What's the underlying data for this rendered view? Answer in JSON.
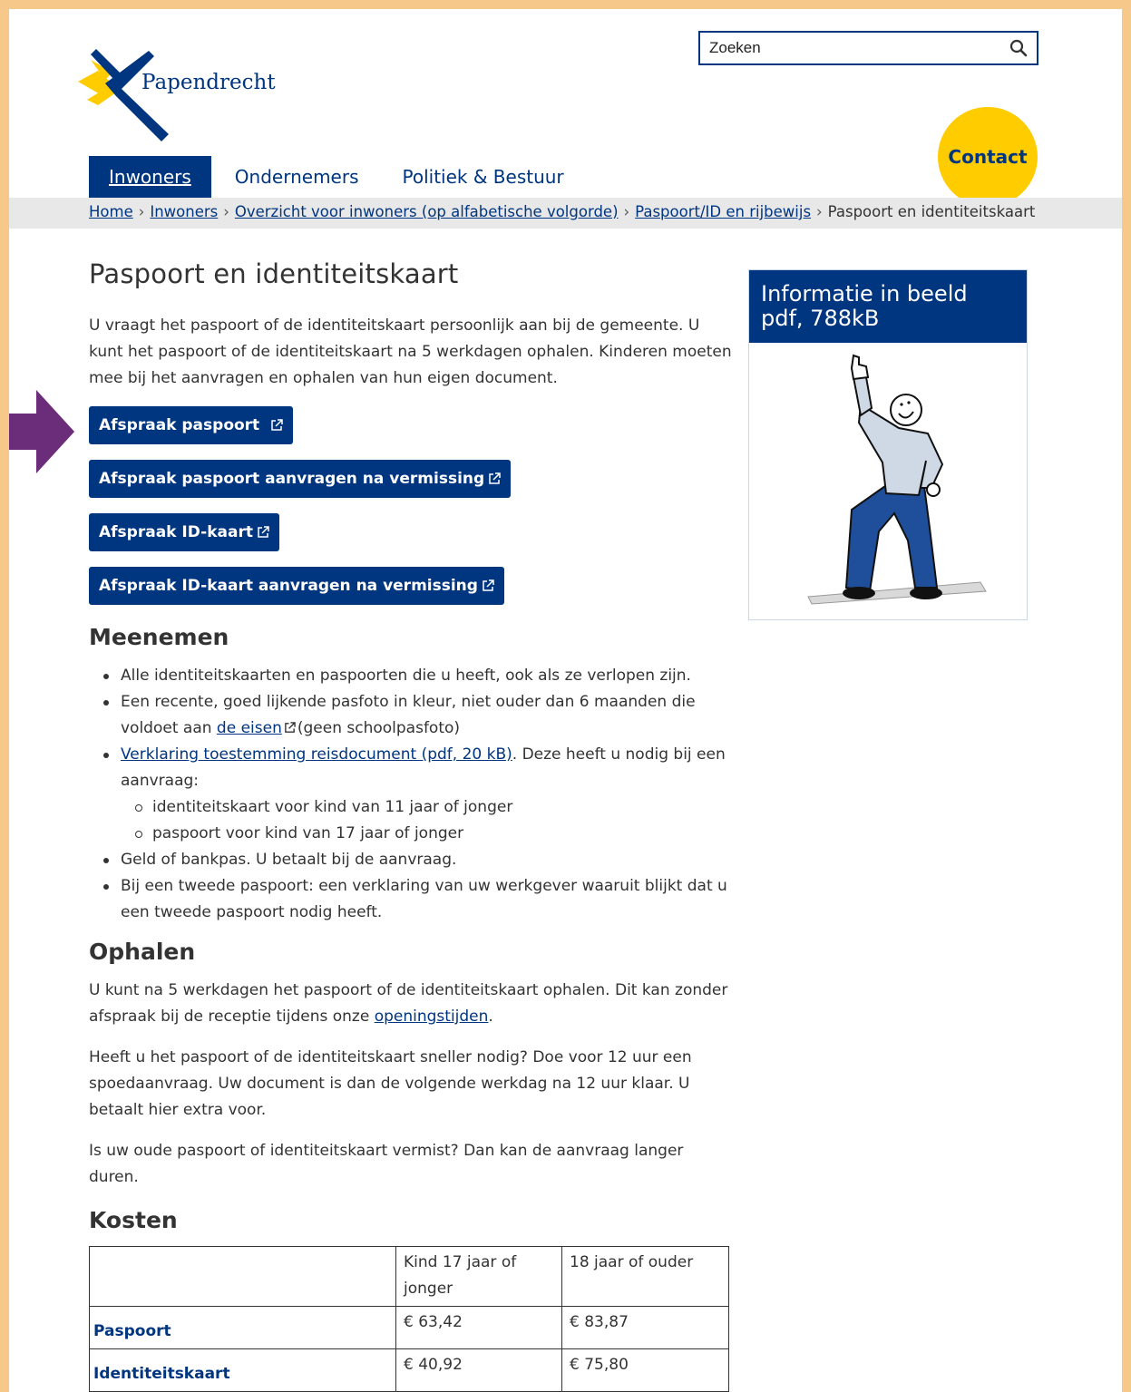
{
  "header": {
    "logo_text": "Papendrecht",
    "search_placeholder": "Zoeken",
    "contact_label": "Contact"
  },
  "nav": {
    "items": [
      {
        "label": "Inwoners",
        "active": true
      },
      {
        "label": "Ondernemers"
      },
      {
        "label": "Politiek & Bestuur"
      }
    ]
  },
  "breadcrumb": {
    "items": [
      "Home",
      "Inwoners",
      "Overzicht voor inwoners (op alfabetische volgorde)",
      "Paspoort/ID en rijbewijs"
    ],
    "current": "Paspoort en identiteitskaart",
    "separator": "›"
  },
  "main": {
    "title": "Paspoort en identiteitskaart",
    "intro": "U vraagt het paspoort of de identiteitskaart persoonlijk aan bij de gemeente. U kunt het paspoort of de identiteitskaart na 5 werkdagen ophalen. Kinderen moeten mee bij het aanvragen en ophalen van hun eigen document.",
    "buttons": [
      "Afspraak paspoort",
      "Afspraak paspoort aanvragen na vermissing",
      "Afspraak ID-kaart",
      "Afspraak ID-kaart aanvragen na vermissing"
    ],
    "meenemen": {
      "heading": "Meenemen",
      "item1": "Alle identiteitskaarten en paspoorten die u heeft, ook als ze verlopen zijn.",
      "item2_pre": "Een recente, goed lijkende pasfoto in kleur, niet ouder dan 6 maanden die voldoet aan",
      "item2_link": "de eisen",
      "item2_post": "(geen schoolpasfoto)",
      "item3_link": "Verklaring toestemming reisdocument (pdf, 20 kB)",
      "item3_post": ". Deze heeft u nodig bij een aanvraag:",
      "sub1": "identiteitskaart voor kind van 11 jaar of jonger",
      "sub2": "paspoort voor kind van 17 jaar of jonger",
      "item4": "Geld of bankpas. U betaalt bij de aanvraag.",
      "item5": "Bij een tweede paspoort: een verklaring van uw werkgever waaruit blijkt dat u een tweede paspoort nodig heeft."
    },
    "ophalen": {
      "heading": "Ophalen",
      "p1_pre": "U kunt na 5 werkdagen het paspoort of de identiteitskaart ophalen. Dit kan zonder afspraak bij de receptie tijdens onze",
      "p1_link": "openingstijden",
      "p1_post": ".",
      "p2": "Heeft u het paspoort of de identiteitskaart sneller nodig? Doe voor 12 uur een spoedaanvraag. Uw document is dan de volgende werkdag na 12 uur klaar. U betaalt hier extra voor.",
      "p3": "Is uw oude paspoort of identiteitskaart vermist? Dan kan de aanvraag langer duren."
    },
    "kosten": {
      "heading": "Kosten",
      "col1": "Kind 17 jaar of jonger",
      "col2": "18 jaar of ouder",
      "rows": [
        {
          "label": "Paspoort",
          "kind": "€ 63,42",
          "volwassen": "€ 83,87"
        },
        {
          "label": "Identiteitskaart",
          "kind": "€ 40,92",
          "volwassen": "€ 75,80"
        }
      ]
    }
  },
  "sidebar": {
    "card_title": "Informatie in beeld pdf, 788kB"
  },
  "colors": {
    "brand_blue": "#003580",
    "contact_yellow": "#ffcc00",
    "frame_orange": "#f6c98a",
    "arrow_purple": "#6b2c7a"
  },
  "icons": [
    "search-icon",
    "external-link-icon",
    "pointer-arrow-icon",
    "logo-icon"
  ]
}
